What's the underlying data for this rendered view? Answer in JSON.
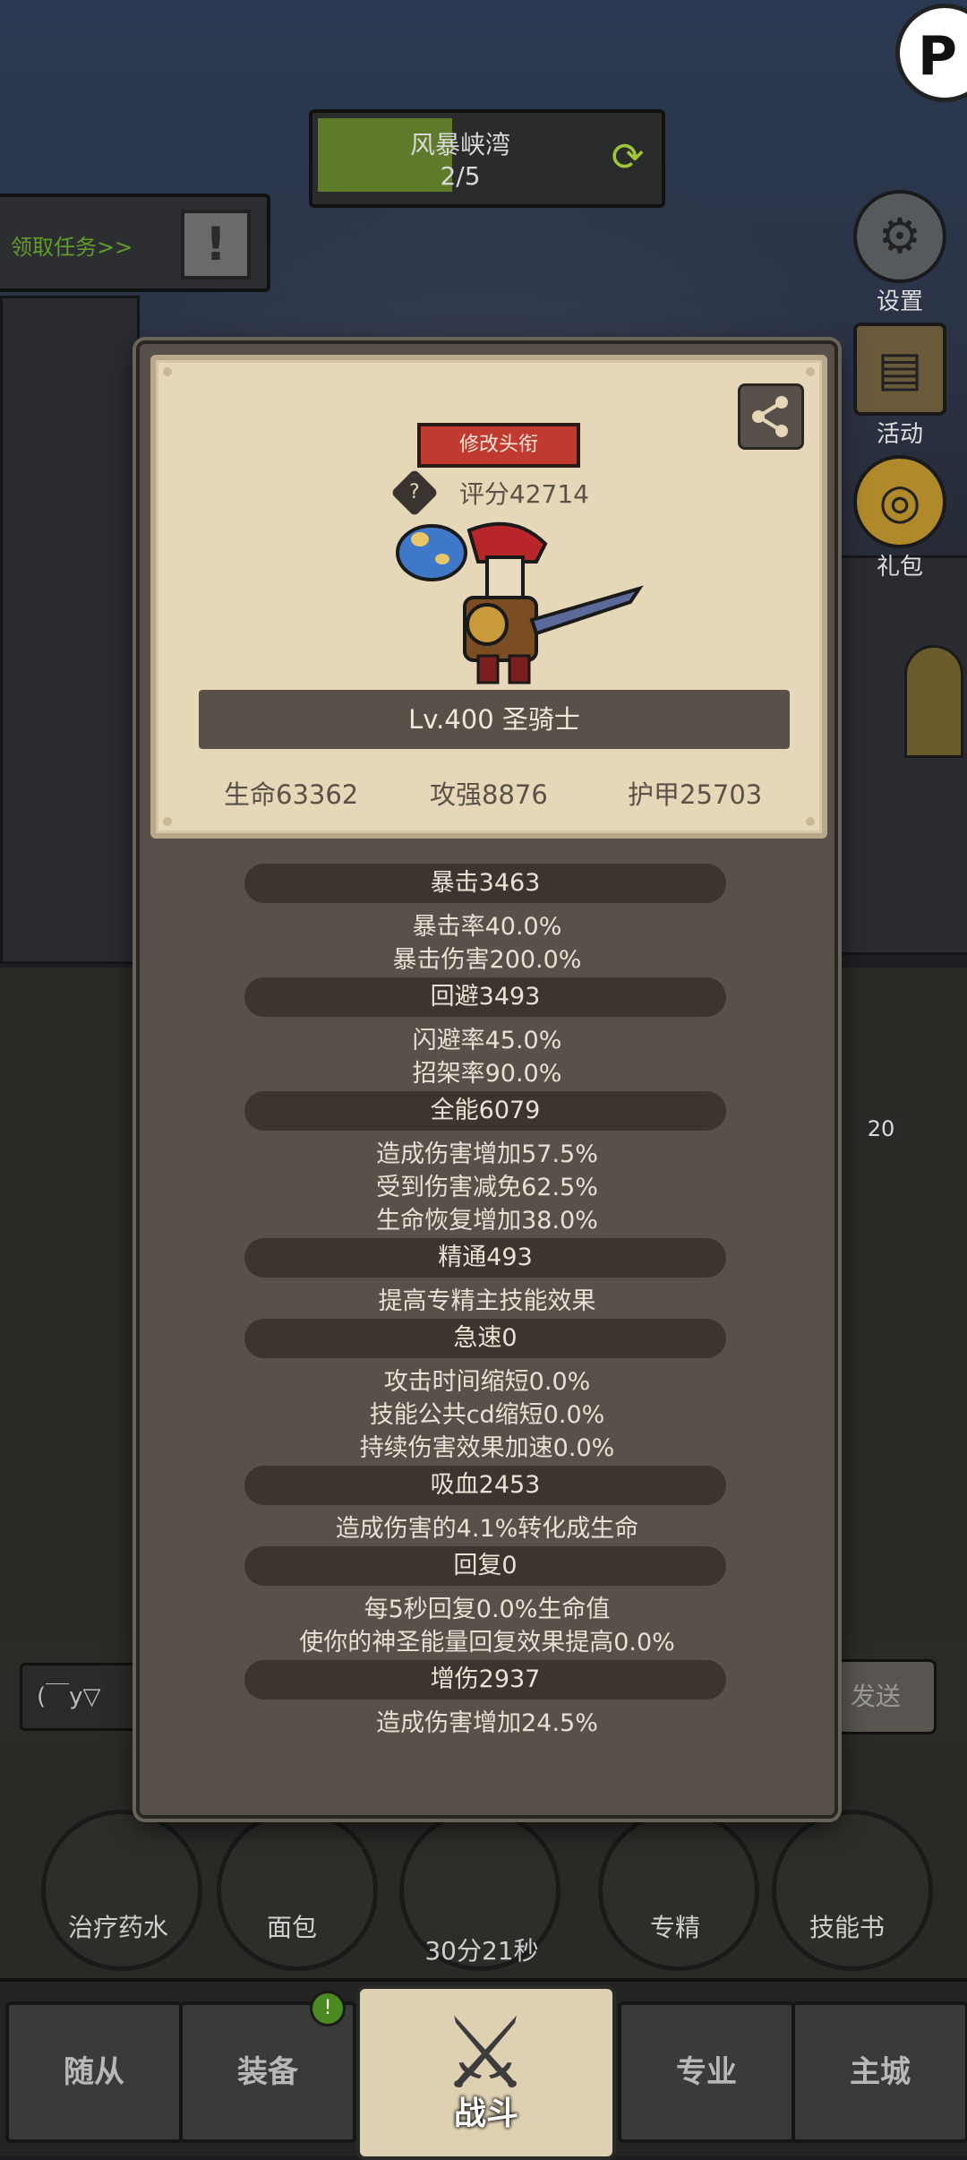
{
  "stage": {
    "name": "风暴峡湾",
    "progress": "2/5"
  },
  "task": {
    "label": "领取任务>>"
  },
  "side_menu": [
    {
      "label": "设置",
      "icon": "gear-icon"
    },
    {
      "label": "活动",
      "icon": "scroll-icon"
    },
    {
      "label": "礼包",
      "icon": "gift-icon"
    }
  ],
  "panel": {
    "title_button": "修改头衔",
    "score": "评分42714",
    "level": "Lv.400 圣骑士",
    "main_stats": [
      "生命63362",
      "攻强8876",
      "护甲25703"
    ],
    "stat_groups": [
      {
        "name": "暴击3463",
        "lines": [
          "暴击率40.0%",
          "暴击伤害200.0%"
        ]
      },
      {
        "name": "回避3493",
        "lines": [
          "闪避率45.0%",
          "招架率90.0%"
        ]
      },
      {
        "name": "全能6079",
        "lines": [
          "造成伤害增加57.5%",
          "受到伤害减免62.5%",
          "生命恢复增加38.0%"
        ]
      },
      {
        "name": "精通493",
        "lines": [
          "提高专精主技能效果"
        ]
      },
      {
        "name": "急速0",
        "lines": [
          "攻击时间缩短0.0%",
          "技能公共cd缩短0.0%",
          "持续伤害效果加速0.0%"
        ]
      },
      {
        "name": "吸血2453",
        "lines": [
          "造成伤害的4.1%转化成生命"
        ]
      },
      {
        "name": "回复0",
        "lines": [
          "每5秒回复0.0%生命值",
          "使你的神圣能量回复效果提高0.0%"
        ]
      },
      {
        "name": "增伤2937",
        "lines": [
          "造成伤害增加24.5%"
        ]
      }
    ]
  },
  "chat": {
    "input_text": "(￣y▽",
    "send_label": "发送"
  },
  "skill_number": "20",
  "bottom_actions": [
    "治疗药水",
    "面包",
    "30分21秒",
    "专精",
    "技能书"
  ],
  "nav": {
    "tabs": [
      "随从",
      "装备",
      "战斗",
      "专业",
      "主城"
    ],
    "badge": "!"
  },
  "colors": {
    "title_button": "#c03a30",
    "panel_bg": "#58514a",
    "card_bg": "#e5d7b8",
    "stage_fill": "#5f7a2a"
  }
}
